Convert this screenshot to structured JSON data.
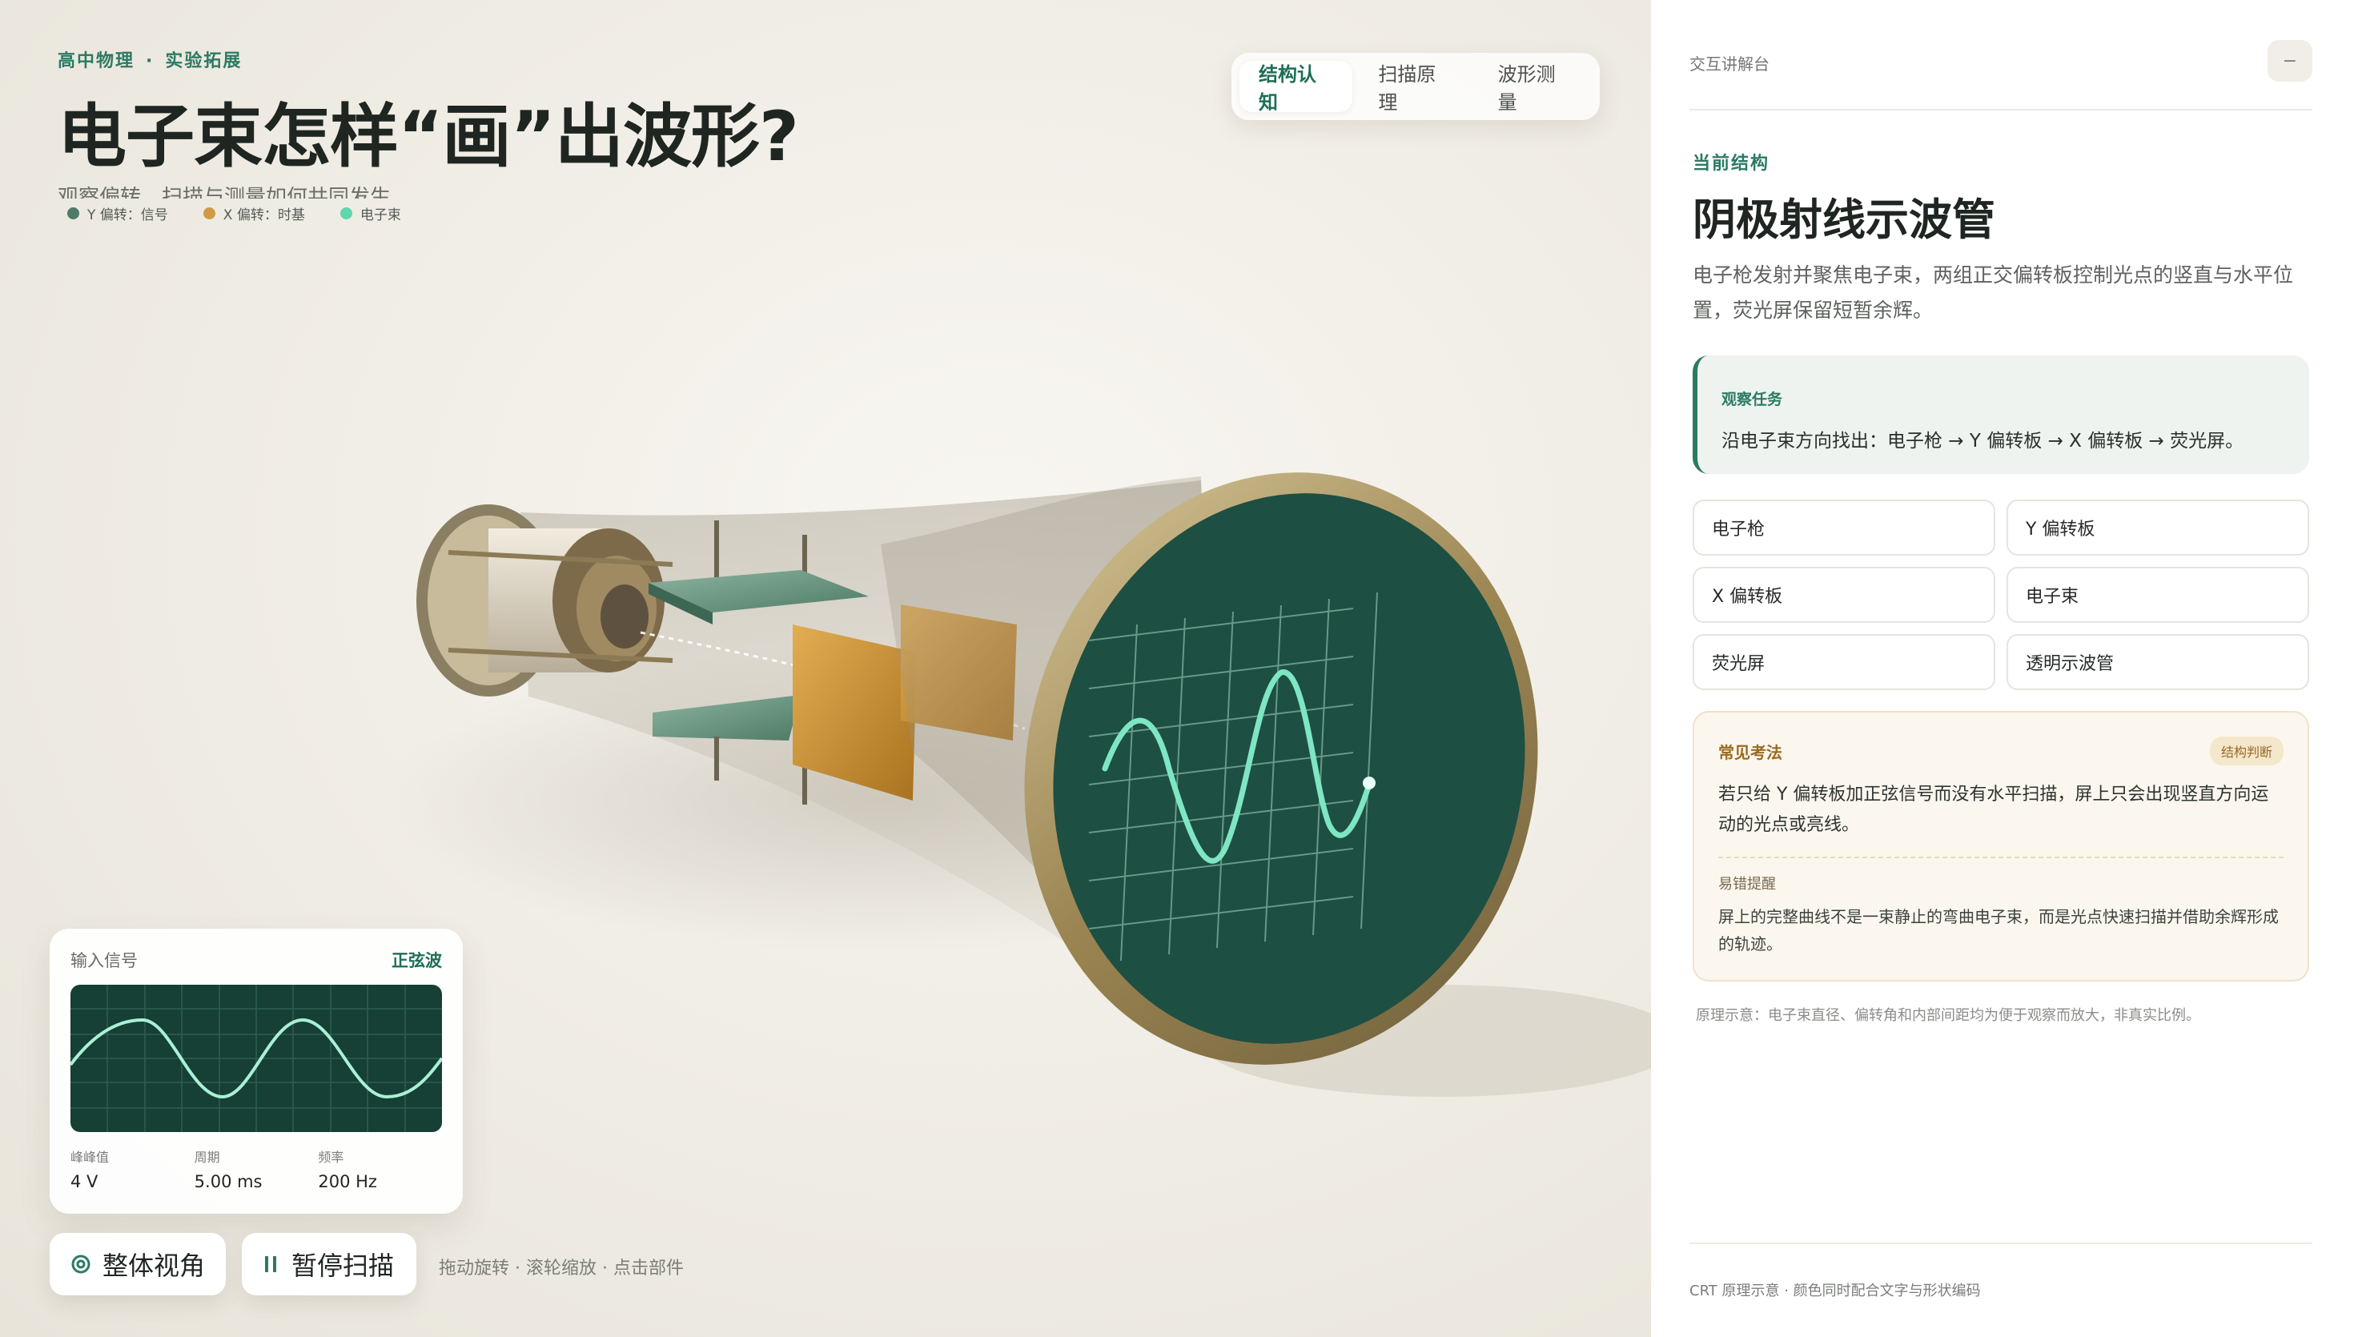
{
  "header": {
    "eyebrow_subject": "高中物理",
    "eyebrow_separator": "·",
    "eyebrow_category": "实验拓展",
    "title": "电子束怎样“画”出波形?",
    "subtitle": "观察偏转、扫描与测量如何共同发生"
  },
  "legend": [
    {
      "label": "Y 偏转：信号",
      "color": "#4f7a6b"
    },
    {
      "label": "X 偏转：时基",
      "color": "#d09a45"
    },
    {
      "label": "电子束",
      "color": "#5fd6b0"
    }
  ],
  "tabs": [
    {
      "label": "结构认知",
      "active": true
    },
    {
      "label": "扫描原理",
      "active": false
    },
    {
      "label": "波形测量",
      "active": false
    }
  ],
  "signal_card": {
    "label": "输入信号",
    "type": "正弦波",
    "waveform": "sine",
    "stats": [
      {
        "key": "峰峰值",
        "value": "4 V"
      },
      {
        "key": "周期",
        "value": "5.00 ms"
      },
      {
        "key": "频率",
        "value": "200 Hz"
      }
    ]
  },
  "controls": {
    "overall_view": "整体视角",
    "overall_icon": "target-icon",
    "pause_scan": "暂停扫描",
    "pause_icon": "pause-icon",
    "hint": "拖动旋转 · 滚轮缩放 · 点击部件"
  },
  "panel": {
    "header": "交互讲解台",
    "collapse_symbol": "−",
    "current_label": "当前结构",
    "current_title": "阴极射线示波管",
    "description": "电子枪发射并聚焦电子束，两组正交偏转板控制光点的竖直与水平位置，荧光屏保留短暂余辉。",
    "task_label": "观察任务",
    "task_text": "沿电子束方向找出：电子枪 → Y 偏转板 → X 偏转板 → 荧光屏。",
    "components": [
      "电子枪",
      "Y 偏转板",
      "X 偏转板",
      "电子束",
      "荧光屏",
      "透明示波管"
    ],
    "exam_label": "常见考法",
    "exam_badge": "结构判断",
    "exam_text": "若只给 Y 偏转板加正弦信号而没有水平扫描，屏上只会出现竖直方向运动的光点或亮线。",
    "mistake_label": "易错提醒",
    "mistake_text": "屏上的完整曲线不是一束静止的弯曲电子束，而是光点快速扫描并借助余辉形成的轨迹。",
    "note": "原理示意：电子束直径、偏转角和内部间距均为便于观察而放大，非真实比例。",
    "footer": "CRT 原理示意 · 颜色同时配合文字与形状编码"
  },
  "colors": {
    "accent_green": "#2c7a63",
    "screen": "#1e4f43",
    "trace": "#7ee6c3",
    "plate_y": "#5f8f7a",
    "plate_x": "#c9902f",
    "rim": "#a8945f"
  }
}
